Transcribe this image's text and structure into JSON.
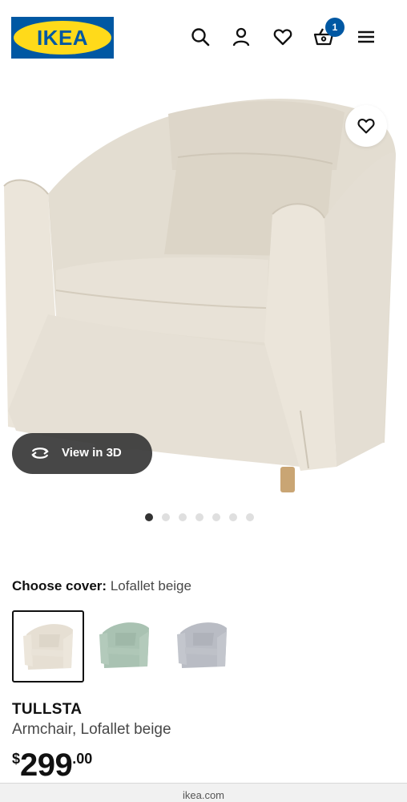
{
  "header": {
    "logo_text": "IKEA",
    "icons": [
      "search-icon",
      "user-icon",
      "heart-icon",
      "cart-icon",
      "menu-icon"
    ],
    "cart_count": "1"
  },
  "hero": {
    "favorite_icon": "heart-icon",
    "view_3d_label": "View in 3D",
    "view_3d_icon": "rotate-3d-icon",
    "carousel": {
      "total": 7,
      "active_index": 0
    }
  },
  "cover": {
    "label": "Choose cover:",
    "selected_value": "Lofallet beige",
    "swatches": [
      {
        "name": "Lofallet beige",
        "color": "#e6dfd3",
        "selected": true
      },
      {
        "name": "green",
        "color": "#a9c2b2",
        "selected": false
      },
      {
        "name": "grey",
        "color": "#b9bcc4",
        "selected": false
      }
    ]
  },
  "product": {
    "name": "TULLSTA",
    "description": "Armchair, Lofallet beige",
    "price_currency": "$",
    "price_integer": "299",
    "price_decimal": ".00"
  },
  "browser": {
    "url": "ikea.com"
  },
  "colors": {
    "brand_blue": "#0058a3",
    "brand_yellow": "#ffda1a",
    "chair_fabric": "#e6e0d5",
    "overlay_dark": "#373737"
  }
}
